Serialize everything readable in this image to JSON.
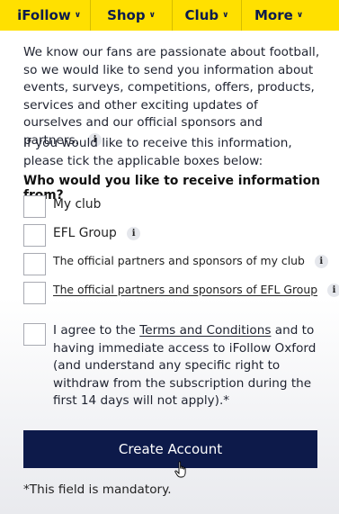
{
  "nav": {
    "items": [
      {
        "label": "iFollow"
      },
      {
        "label": "Shop"
      },
      {
        "label": "Club"
      },
      {
        "label": "More"
      }
    ],
    "chevron_icon": "chevron-down-icon",
    "bg_color": "#ffe000",
    "text_color": "#0b1b4e"
  },
  "intro": {
    "text": "We know our fans are passionate about football, so we would like to send you information about events, surveys, competitions, offers, products, services and other exciting updates of ourselves and our official sponsors and partners.",
    "info_icon": "i"
  },
  "tick_instruction": "If you would like to receive this information, please tick the applicable boxes below:",
  "question": "Who would you like to receive information from?",
  "options": [
    {
      "label": "My club",
      "has_info": false,
      "checked": false
    },
    {
      "label": "EFL Group",
      "has_info": true,
      "checked": false
    },
    {
      "label": "The official partners and sponsors of my club",
      "has_info": true,
      "checked": false
    },
    {
      "label": "The official partners and sponsors of EFL Group",
      "has_info": true,
      "checked": false
    }
  ],
  "agreement": {
    "prefix": "I agree to the ",
    "link": "Terms and Conditions",
    "suffix": " and to having immediate access to iFollow Oxford (and understand any specific right to withdraw from the subscription during the first 14 days will not apply).*",
    "checked": false
  },
  "create_button": {
    "label": "Create Account",
    "color": "#0d1a4a"
  },
  "mandatory_note": "*This field is mandatory."
}
